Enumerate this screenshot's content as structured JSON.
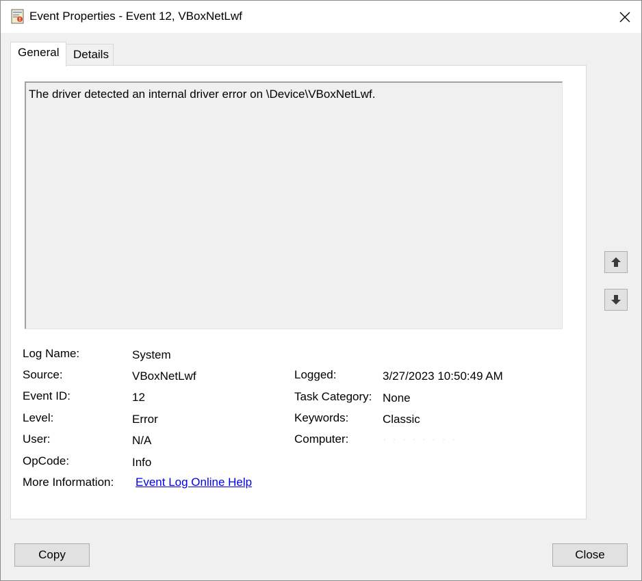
{
  "window": {
    "title": "Event Properties - Event 12, VBoxNetLwf"
  },
  "tabs": [
    {
      "label": "General",
      "active": true
    },
    {
      "label": "Details",
      "active": false
    }
  ],
  "description": "The driver detected an internal driver error on \\Device\\VBoxNetLwf.",
  "fields": {
    "log_name_label": "Log Name:",
    "log_name": "System",
    "source_label": "Source:",
    "source": "VBoxNetLwf",
    "event_id_label": "Event ID:",
    "event_id": "12",
    "level_label": "Level:",
    "level": "Error",
    "user_label": "User:",
    "user": "N/A",
    "opcode_label": "OpCode:",
    "opcode": "Info",
    "more_info_label": "More Information:",
    "more_info_link": "Event Log Online Help",
    "logged_label": "Logged:",
    "logged": "3/27/2023 10:50:49 AM",
    "task_category_label": "Task Category:",
    "task_category": "None",
    "keywords_label": "Keywords:",
    "keywords": "Classic",
    "computer_label": "Computer:",
    "computer": "· · · · · · · ·"
  },
  "buttons": {
    "copy": "Copy",
    "close": "Close"
  },
  "icons": {
    "app": "event-viewer-icon",
    "close": "close-icon",
    "up": "arrow-up-icon",
    "down": "arrow-down-icon"
  }
}
